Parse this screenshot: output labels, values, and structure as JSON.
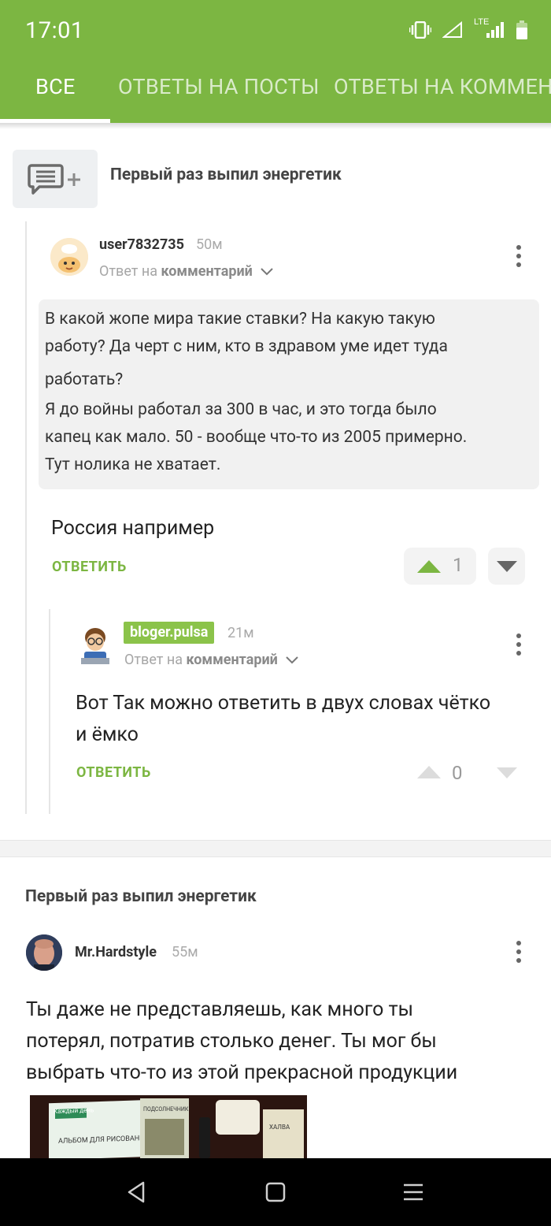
{
  "status": {
    "time": "17:01",
    "network": "LTE"
  },
  "tabs": [
    {
      "label": "ВСЕ"
    },
    {
      "label": "ОТВЕТЫ НА ПОСТЫ"
    },
    {
      "label": "ОТВЕТЫ НА КОММЕНТАРИИ"
    }
  ],
  "post1": {
    "title": "Первый раз выпил энергетик",
    "comment1": {
      "user": "user7832735",
      "time": "50м",
      "reply_prefix": "Ответ на",
      "reply_target": "комментарий",
      "quote_lines": [
        "В какой жопе мира такие ставки? На какую такую",
        "работу? Да черт с ним, кто в здравом уме идет туда",
        "работать?",
        "Я до войны работал за 300 в час, и это тогда было",
        "капец как мало. 50 - вообще что-то из 2005 примерно.",
        "Тут нолика не хватает."
      ],
      "text": "Россия например",
      "reply_label": "ОТВЕТИТЬ",
      "votes": "1"
    },
    "comment2": {
      "user": "bloger.pulsa",
      "time": "21м",
      "reply_prefix": "Ответ на",
      "reply_target": "комментарий",
      "text_lines": [
        "Вот Так можно ответить в двух словах чётко",
        "и ёмко"
      ],
      "reply_label": "ОТВЕТИТЬ",
      "votes": "0"
    }
  },
  "post2": {
    "title": "Первый раз выпил энергетик",
    "comment": {
      "user": "Mr.Hardstyle",
      "time": "55м",
      "text_lines": [
        "Ты даже не представляешь, как много ты",
        "потерял, потратив столько денег. Ты мог бы",
        "выбрать что-то из этой прекрасной продукции"
      ],
      "image_text": [
        "АЛЬБОМ ДЛЯ РИСОВАНИЯ",
        "ПОДСОЛНЕЧНИК",
        "ХАЛВА",
        "Каждый день"
      ]
    }
  },
  "colors": {
    "brand": "#7cb642",
    "bloger_badge": "#8bc34a"
  }
}
